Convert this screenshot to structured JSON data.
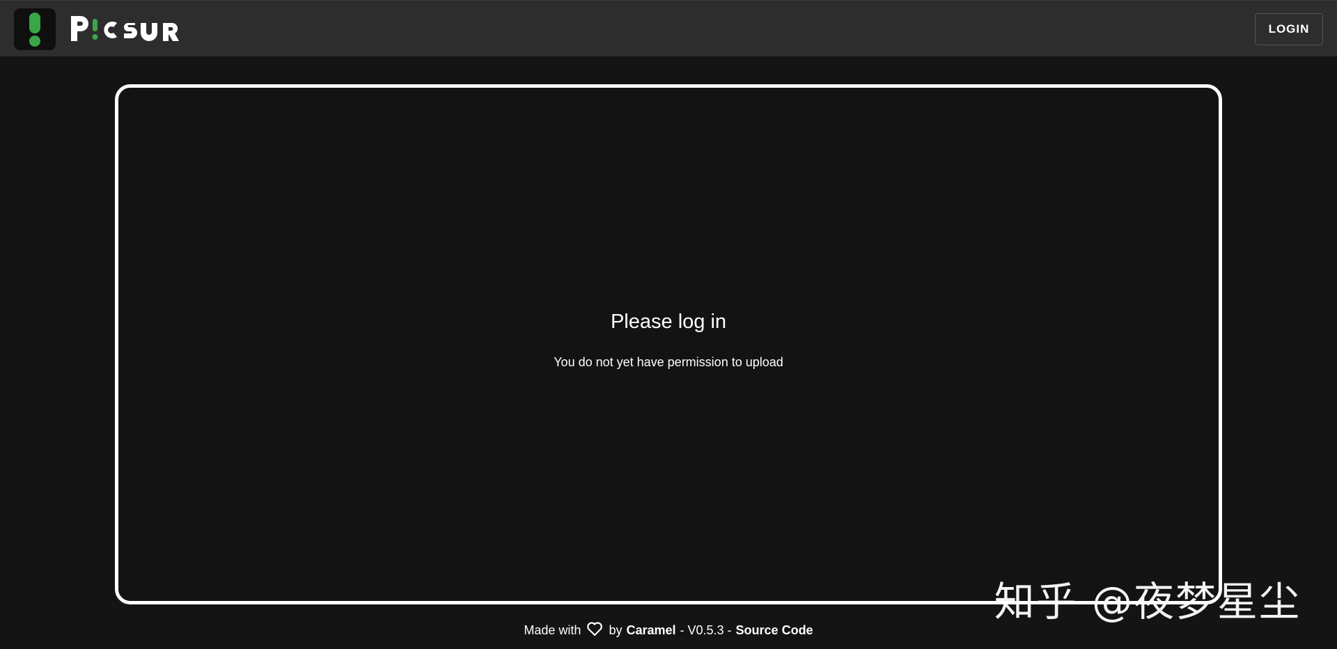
{
  "app": {
    "logo_text": "PICSUR",
    "logo_icon": "exclamation-logo-icon",
    "accent_color": "#3aa648"
  },
  "header": {
    "login_label": "LOGIN"
  },
  "upload": {
    "title": "Please log in",
    "subtitle": "You do not yet have permission to upload"
  },
  "footer": {
    "made_with": "Made with",
    "heart_icon": "heart-icon",
    "by": "by",
    "author": "Caramel",
    "version_sep": "- V0.5.3 -",
    "source_code": "Source Code"
  },
  "watermark": {
    "text": "知乎 @夜梦星尘"
  }
}
